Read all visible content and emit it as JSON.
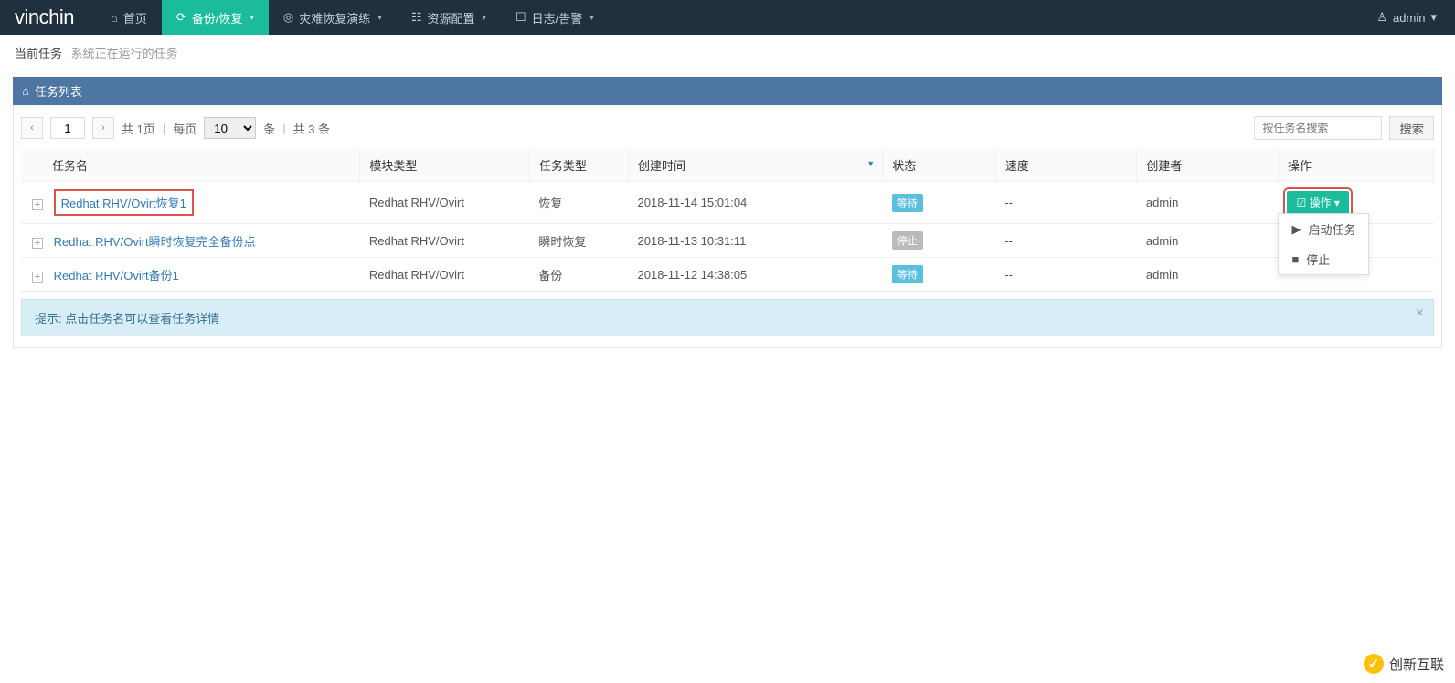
{
  "brand": "vinchin",
  "nav": {
    "home": "首页",
    "backup": "备份/恢复",
    "dr": "灾难恢复演练",
    "resource": "资源配置",
    "log": "日志/告警"
  },
  "user": {
    "name": "admin"
  },
  "page_head": {
    "title": "当前任务",
    "sub": "系统正在运行的任务"
  },
  "panel": {
    "title": "任务列表"
  },
  "pager": {
    "page": "1",
    "total_pages_label": "共 1页",
    "per_page_label": "每页",
    "page_size": "10",
    "unit": "条",
    "total_label": "共 3 条"
  },
  "search": {
    "placeholder": "按任务名搜索",
    "btn": "搜索"
  },
  "columns": {
    "name": "任务名",
    "module": "模块类型",
    "type": "任务类型",
    "created": "创建时间",
    "status": "状态",
    "speed": "速度",
    "creator": "创建者",
    "op": "操作"
  },
  "rows": [
    {
      "name": "Redhat RHV/Ovirt恢复1",
      "module": "Redhat RHV/Ovirt",
      "type": "恢复",
      "created": "2018-11-14 15:01:04",
      "status": "等待",
      "status_kind": "wait",
      "speed": "--",
      "creator": "admin",
      "show_op": true,
      "highlighted": true
    },
    {
      "name": "Redhat RHV/Ovirt瞬时恢复完全备份点",
      "module": "Redhat RHV/Ovirt",
      "type": "瞬时恢复",
      "created": "2018-11-13 10:31:11",
      "status": "停止",
      "status_kind": "stop",
      "speed": "--",
      "creator": "admin",
      "show_op": false,
      "highlighted": false
    },
    {
      "name": "Redhat RHV/Ovirt备份1",
      "module": "Redhat RHV/Ovirt",
      "type": "备份",
      "created": "2018-11-12 14:38:05",
      "status": "等待",
      "status_kind": "wait",
      "speed": "--",
      "creator": "admin",
      "show_op": false,
      "highlighted": false
    }
  ],
  "op_btn": "操作",
  "op_menu": {
    "start": "启动任务",
    "stop": "停止"
  },
  "tip": {
    "prefix": "提示:",
    "text": "点击任务名可以查看任务详情"
  },
  "corner": "创新互联"
}
